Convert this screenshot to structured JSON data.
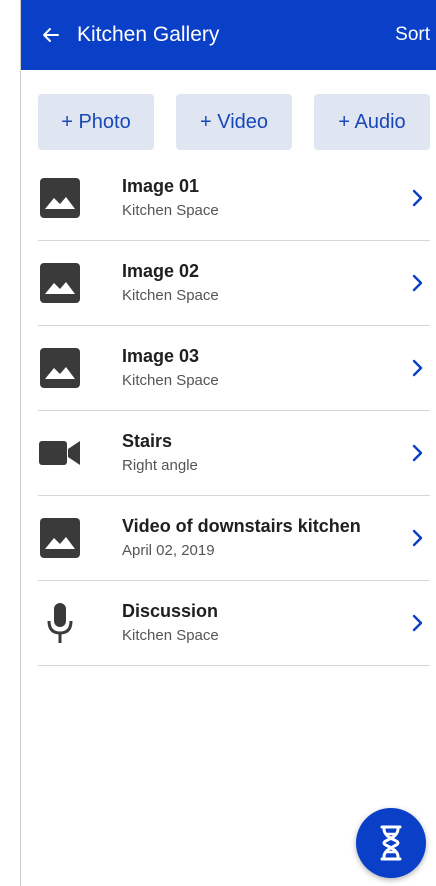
{
  "colors": {
    "primary": "#0a3fc7",
    "action_bg": "#dfe6f2",
    "action_text": "#1947b8",
    "chevron": "#0a3fc7",
    "icon": "#3a3a3a"
  },
  "appbar": {
    "back_icon": "arrow-left-icon",
    "title": "Kitchen Gallery",
    "sort_label": "Sort"
  },
  "actions": [
    {
      "label": "+ Photo"
    },
    {
      "label": "+ Video"
    },
    {
      "label": "+ Audio"
    }
  ],
  "items": [
    {
      "icon": "image-icon",
      "title": "Image 01",
      "subtitle": "Kitchen Space"
    },
    {
      "icon": "image-icon",
      "title": "Image 02",
      "subtitle": "Kitchen Space"
    },
    {
      "icon": "image-icon",
      "title": "Image 03",
      "subtitle": "Kitchen Space"
    },
    {
      "icon": "video-camera-icon",
      "title": "Stairs",
      "subtitle": "Right angle"
    },
    {
      "icon": "image-icon",
      "title": "Video of downstairs kitchen",
      "subtitle": "April 02, 2019"
    },
    {
      "icon": "microphone-icon",
      "title": "Discussion",
      "subtitle": "Kitchen Space"
    }
  ],
  "fab": {
    "icon": "dna-icon"
  }
}
